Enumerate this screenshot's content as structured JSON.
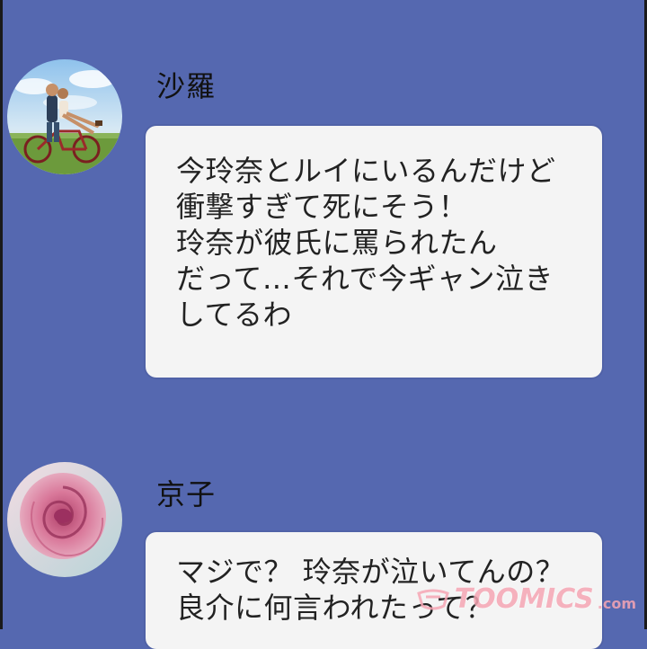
{
  "messages": [
    {
      "sender": "沙羅",
      "avatar_icon": "couple-on-bicycle-avatar",
      "text": "今玲奈とルイにいるんだけど\n衝撃すぎて死にそう！\n玲奈が彼氏に罵られたん\nだって…それで今ギャン泣き\nしてるわ"
    },
    {
      "sender": "京子",
      "avatar_icon": "pink-rose-avatar",
      "text": "マジで？ 玲奈が泣いてんの？\n良介に何言われたって？"
    }
  ],
  "watermark": {
    "brand": "TOOMICS",
    "domain": ".com"
  },
  "colors": {
    "background": "#5568b0",
    "bubble": "#f4f4f4",
    "watermark": "#f6a6b4"
  }
}
